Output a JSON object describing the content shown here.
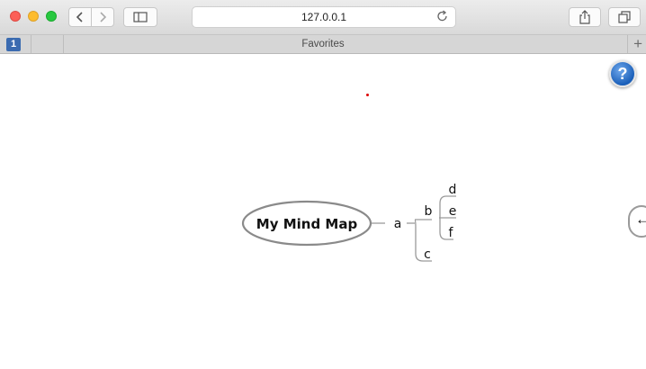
{
  "browser": {
    "url": "127.0.0.1",
    "favorites_title": "Favorites",
    "tab_badge": "1"
  },
  "page": {
    "help_label": "?",
    "side_toggle_icon": "←",
    "mindmap": {
      "root": "My Mind Map",
      "nodes": {
        "a": "a",
        "b": "b",
        "c": "c",
        "d": "d",
        "e": "e",
        "f": "f"
      }
    }
  },
  "colors": {
    "link_line": "#9a9a9a",
    "root_border": "#8a8a8a",
    "help_blue": "#1a5fb9",
    "dot_red": "#dd0000"
  }
}
